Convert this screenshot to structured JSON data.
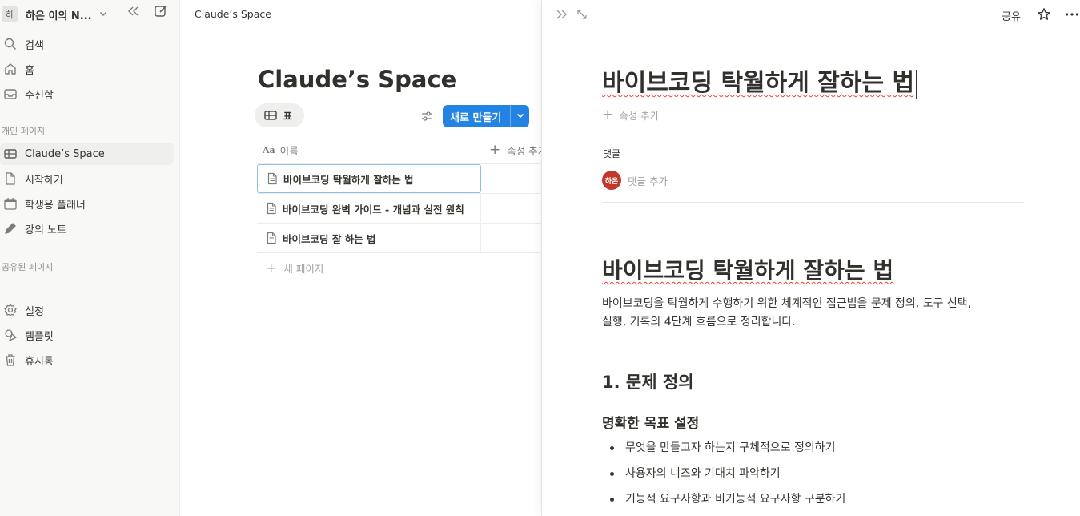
{
  "sidebar": {
    "workspace": {
      "avatar": "하",
      "name": "하은 이의 N..."
    },
    "nav": [
      {
        "label": "검색",
        "icon": "search-icon"
      },
      {
        "label": "홈",
        "icon": "home-icon"
      },
      {
        "label": "수신함",
        "icon": "inbox-icon"
      }
    ],
    "private_section": "개인 페이지",
    "private_pages": [
      {
        "label": "Claude’s Space",
        "icon": "table-icon",
        "active": true
      },
      {
        "label": "시작하기",
        "icon": "doc-icon"
      },
      {
        "label": "학생용 플래너",
        "icon": "calendar-icon"
      },
      {
        "label": "강의 노트",
        "icon": "pen-icon"
      }
    ],
    "shared_section": "공유된 페이지",
    "bottom": [
      {
        "label": "설정",
        "icon": "gear-icon"
      },
      {
        "label": "템플릿",
        "icon": "template-icon"
      },
      {
        "label": "휴지통",
        "icon": "trash-icon"
      }
    ]
  },
  "middle": {
    "breadcrumb": "Claude’s Space",
    "title": "Claude’s Space",
    "view_tab": "표",
    "new_button": "새로 만들기",
    "columns": {
      "name": "이름",
      "add_property": "속성 추가"
    },
    "rows": [
      "바이브코딩 탁월하게 잘하는 법",
      "바이브코딩 완벽 가이드 - 개념과 실전 원칙",
      "바이브코딩 잘 하는 법"
    ],
    "new_page": "새 페이지"
  },
  "peek": {
    "share": "공유",
    "title": "바이브코딩 탁월하게 잘하는 법",
    "add_property": "속성 추가",
    "comments_label": "댓글",
    "comment_avatar": "하은",
    "comment_placeholder": "댓글 추가",
    "h1": "바이브코딩 탁월하게 잘하는 법",
    "intro_line1": "바이브코딩을 탁월하게 수행하기 위한 체계적인 접근법을 문제 정의, 도구 선택,",
    "intro_line2": "실행, 기록의 4단계 흐름으로 정리합니다.",
    "h2": "1. 문제 정의",
    "h3": "명확한 목표 설정",
    "bullets": [
      "무엇을 만들고자 하는지 구체적으로 정의하기",
      "사용자의 니즈와 기대치 파악하기",
      "기능적 요구사항과 비기능적 요구사항 구분하기"
    ]
  },
  "colors": {
    "accent": "#2383e2",
    "avatar": "#c0392b",
    "sidebar_bg": "#f8f8f7"
  }
}
